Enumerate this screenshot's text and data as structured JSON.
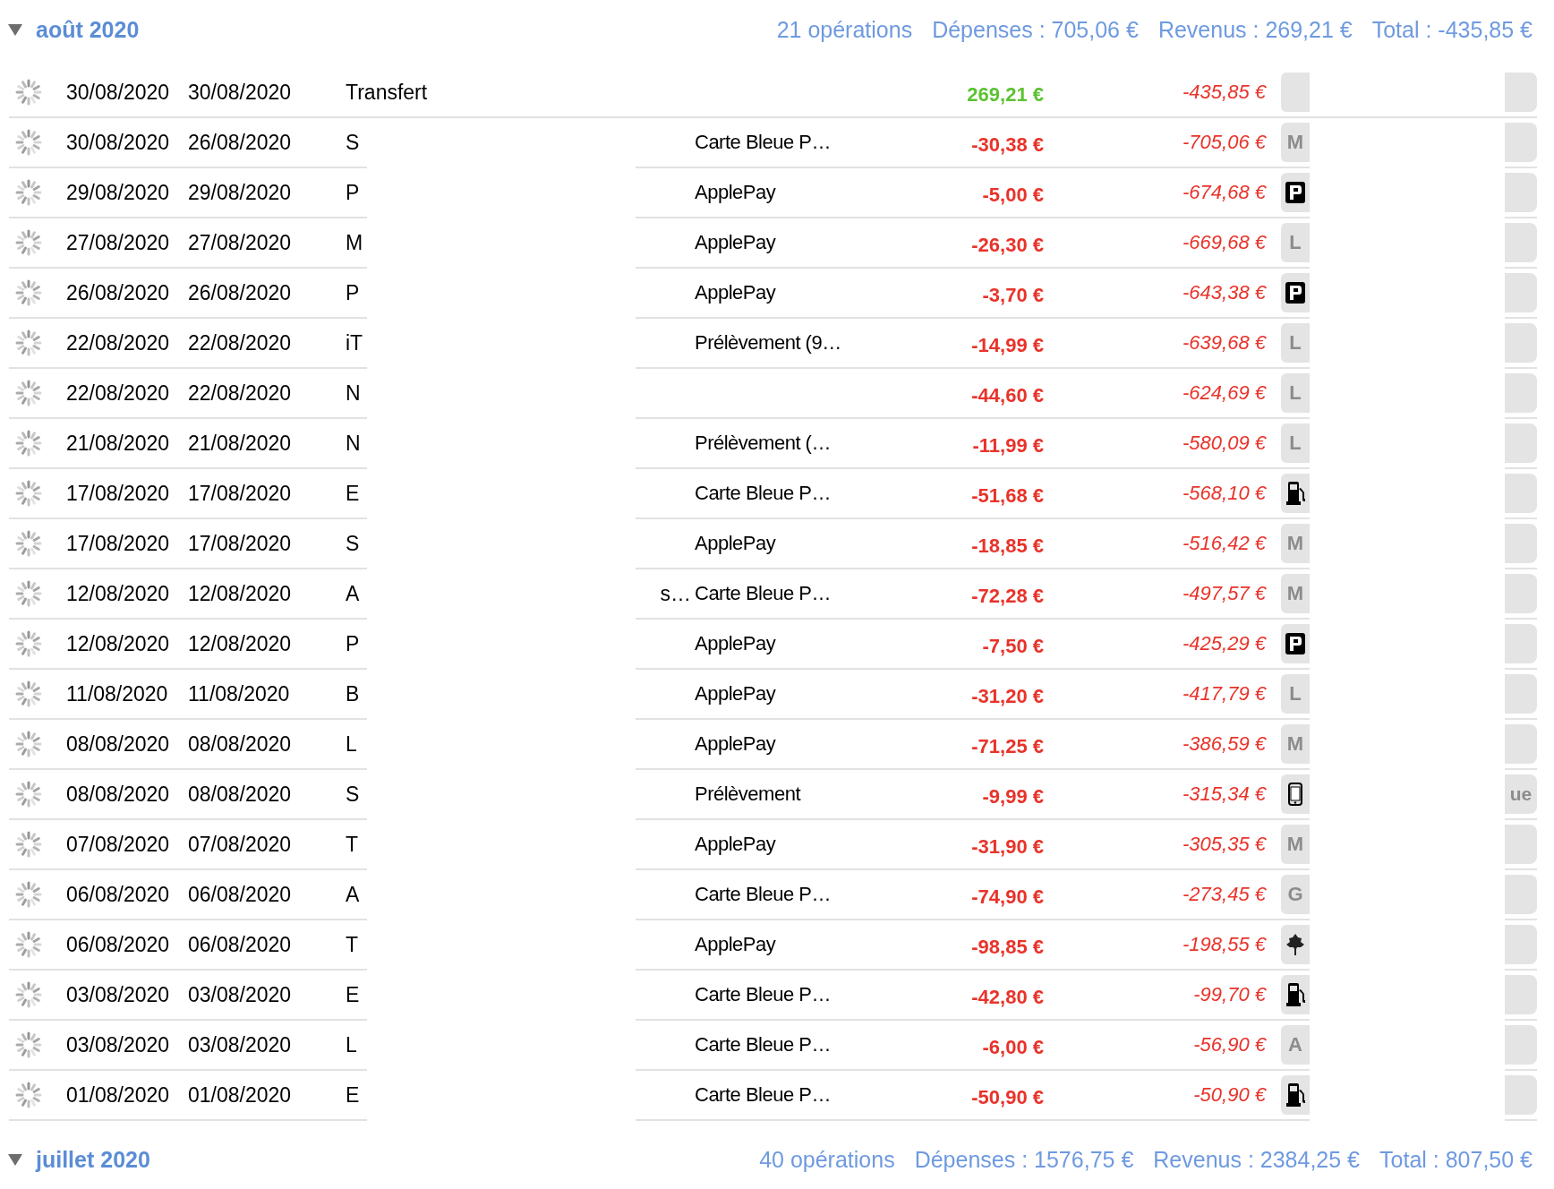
{
  "groups": [
    {
      "title": "août 2020",
      "expanded": true,
      "summary": [
        "21 opérations",
        "Dépenses : 705,06 €",
        "Revenus : 269,21 €",
        "Total : -435,85 €"
      ],
      "rows": [
        {
          "date": "30/08/2020",
          "value_date": "30/08/2020",
          "payee": "Transfert",
          "mode": "",
          "amount": "269,21 €",
          "kind": "income",
          "balance": "-435,85 €",
          "category": {
            "kind": "none"
          },
          "tag": ""
        },
        {
          "date": "30/08/2020",
          "value_date": "26/08/2020",
          "payee": "S",
          "mode": "Carte Bleue P…",
          "amount": "-30,38 €",
          "kind": "expense",
          "balance": "-705,06 €",
          "category": {
            "kind": "text",
            "text": "M"
          },
          "tag": ""
        },
        {
          "date": "29/08/2020",
          "value_date": "29/08/2020",
          "payee": "P",
          "mode": "ApplePay",
          "amount": "-5,00 €",
          "kind": "expense",
          "balance": "-674,68 €",
          "category": {
            "kind": "parking"
          },
          "tag": ""
        },
        {
          "date": "27/08/2020",
          "value_date": "27/08/2020",
          "payee": "M",
          "mode": "ApplePay",
          "amount": "-26,30 €",
          "kind": "expense",
          "balance": "-669,68 €",
          "category": {
            "kind": "text",
            "text": "L"
          },
          "tag": ""
        },
        {
          "date": "26/08/2020",
          "value_date": "26/08/2020",
          "payee": "P",
          "mode": "ApplePay",
          "amount": "-3,70 €",
          "kind": "expense",
          "balance": "-643,38 €",
          "category": {
            "kind": "parking"
          },
          "tag": ""
        },
        {
          "date": "22/08/2020",
          "value_date": "22/08/2020",
          "payee": "iT",
          "mode": "Prélèvement (9…",
          "amount": "-14,99 €",
          "kind": "expense",
          "balance": "-639,68 €",
          "category": {
            "kind": "text",
            "text": "L"
          },
          "tag": ""
        },
        {
          "date": "22/08/2020",
          "value_date": "22/08/2020",
          "payee": "N",
          "mode": "",
          "amount": "-44,60 €",
          "kind": "expense",
          "balance": "-624,69 €",
          "category": {
            "kind": "text",
            "text": "L"
          },
          "tag": ""
        },
        {
          "date": "21/08/2020",
          "value_date": "21/08/2020",
          "payee": "N",
          "mode": "Prélèvement (…",
          "amount": "-11,99 €",
          "kind": "expense",
          "balance": "-580,09 €",
          "category": {
            "kind": "text",
            "text": "L"
          },
          "tag": ""
        },
        {
          "date": "17/08/2020",
          "value_date": "17/08/2020",
          "payee": "E",
          "mode": "Carte Bleue P…",
          "amount": "-51,68 €",
          "kind": "expense",
          "balance": "-568,10 €",
          "category": {
            "kind": "fuel"
          },
          "tag": ""
        },
        {
          "date": "17/08/2020",
          "value_date": "17/08/2020",
          "payee": "S",
          "mode": "ApplePay",
          "amount": "-18,85 €",
          "kind": "expense",
          "balance": "-516,42 €",
          "category": {
            "kind": "text",
            "text": "M"
          },
          "tag": ""
        },
        {
          "date": "12/08/2020",
          "value_date": "12/08/2020",
          "payee": "A",
          "fragment": "s…",
          "mode": "Carte Bleue P…",
          "amount": "-72,28 €",
          "kind": "expense",
          "balance": "-497,57 €",
          "category": {
            "kind": "text",
            "text": "M"
          },
          "tag": ""
        },
        {
          "date": "12/08/2020",
          "value_date": "12/08/2020",
          "payee": "P",
          "mode": "ApplePay",
          "amount": "-7,50 €",
          "kind": "expense",
          "balance": "-425,29 €",
          "category": {
            "kind": "parking"
          },
          "tag": ""
        },
        {
          "date": "11/08/2020",
          "value_date": "11/08/2020",
          "payee": "B",
          "mode": "ApplePay",
          "amount": "-31,20 €",
          "kind": "expense",
          "balance": "-417,79 €",
          "category": {
            "kind": "text",
            "text": "L"
          },
          "tag": ""
        },
        {
          "date": "08/08/2020",
          "value_date": "08/08/2020",
          "payee": "L",
          "mode": "ApplePay",
          "amount": "-71,25 €",
          "kind": "expense",
          "balance": "-386,59 €",
          "category": {
            "kind": "text",
            "text": "M"
          },
          "tag": ""
        },
        {
          "date": "08/08/2020",
          "value_date": "08/08/2020",
          "payee": "S",
          "mode": "Prélèvement",
          "amount": "-9,99 €",
          "kind": "expense",
          "balance": "-315,34 €",
          "category": {
            "kind": "phone"
          },
          "tag": "ue"
        },
        {
          "date": "07/08/2020",
          "value_date": "07/08/2020",
          "payee": "T",
          "mode": "ApplePay",
          "amount": "-31,90 €",
          "kind": "expense",
          "balance": "-305,35 €",
          "category": {
            "kind": "text",
            "text": "M"
          },
          "tag": ""
        },
        {
          "date": "06/08/2020",
          "value_date": "06/08/2020",
          "payee": "A",
          "mode": "Carte Bleue P…",
          "amount": "-74,90 €",
          "kind": "expense",
          "balance": "-273,45 €",
          "category": {
            "kind": "text",
            "text": "G"
          },
          "tag": ""
        },
        {
          "date": "06/08/2020",
          "value_date": "06/08/2020",
          "payee": "T",
          "mode": "ApplePay",
          "amount": "-98,85 €",
          "kind": "expense",
          "balance": "-198,55 €",
          "category": {
            "kind": "tree"
          },
          "tag": ""
        },
        {
          "date": "03/08/2020",
          "value_date": "03/08/2020",
          "payee": "E",
          "mode": "Carte Bleue P…",
          "amount": "-42,80 €",
          "kind": "expense",
          "balance": "-99,70 €",
          "category": {
            "kind": "fuel"
          },
          "tag": ""
        },
        {
          "date": "03/08/2020",
          "value_date": "03/08/2020",
          "payee": "L",
          "mode": "Carte Bleue P…",
          "amount": "-6,00 €",
          "kind": "expense",
          "balance": "-56,90 €",
          "category": {
            "kind": "text",
            "text": "A"
          },
          "tag": ""
        },
        {
          "date": "01/08/2020",
          "value_date": "01/08/2020",
          "payee": "E",
          "mode": "Carte Bleue P…",
          "amount": "-50,90 €",
          "kind": "expense",
          "balance": "-50,90 €",
          "category": {
            "kind": "fuel"
          },
          "tag": ""
        }
      ]
    },
    {
      "title": "juillet 2020",
      "expanded": true,
      "summary": [
        "40 opérations",
        "Dépenses : 1576,75 €",
        "Revenus : 2384,25 €",
        "Total : 807,50 €"
      ]
    }
  ]
}
